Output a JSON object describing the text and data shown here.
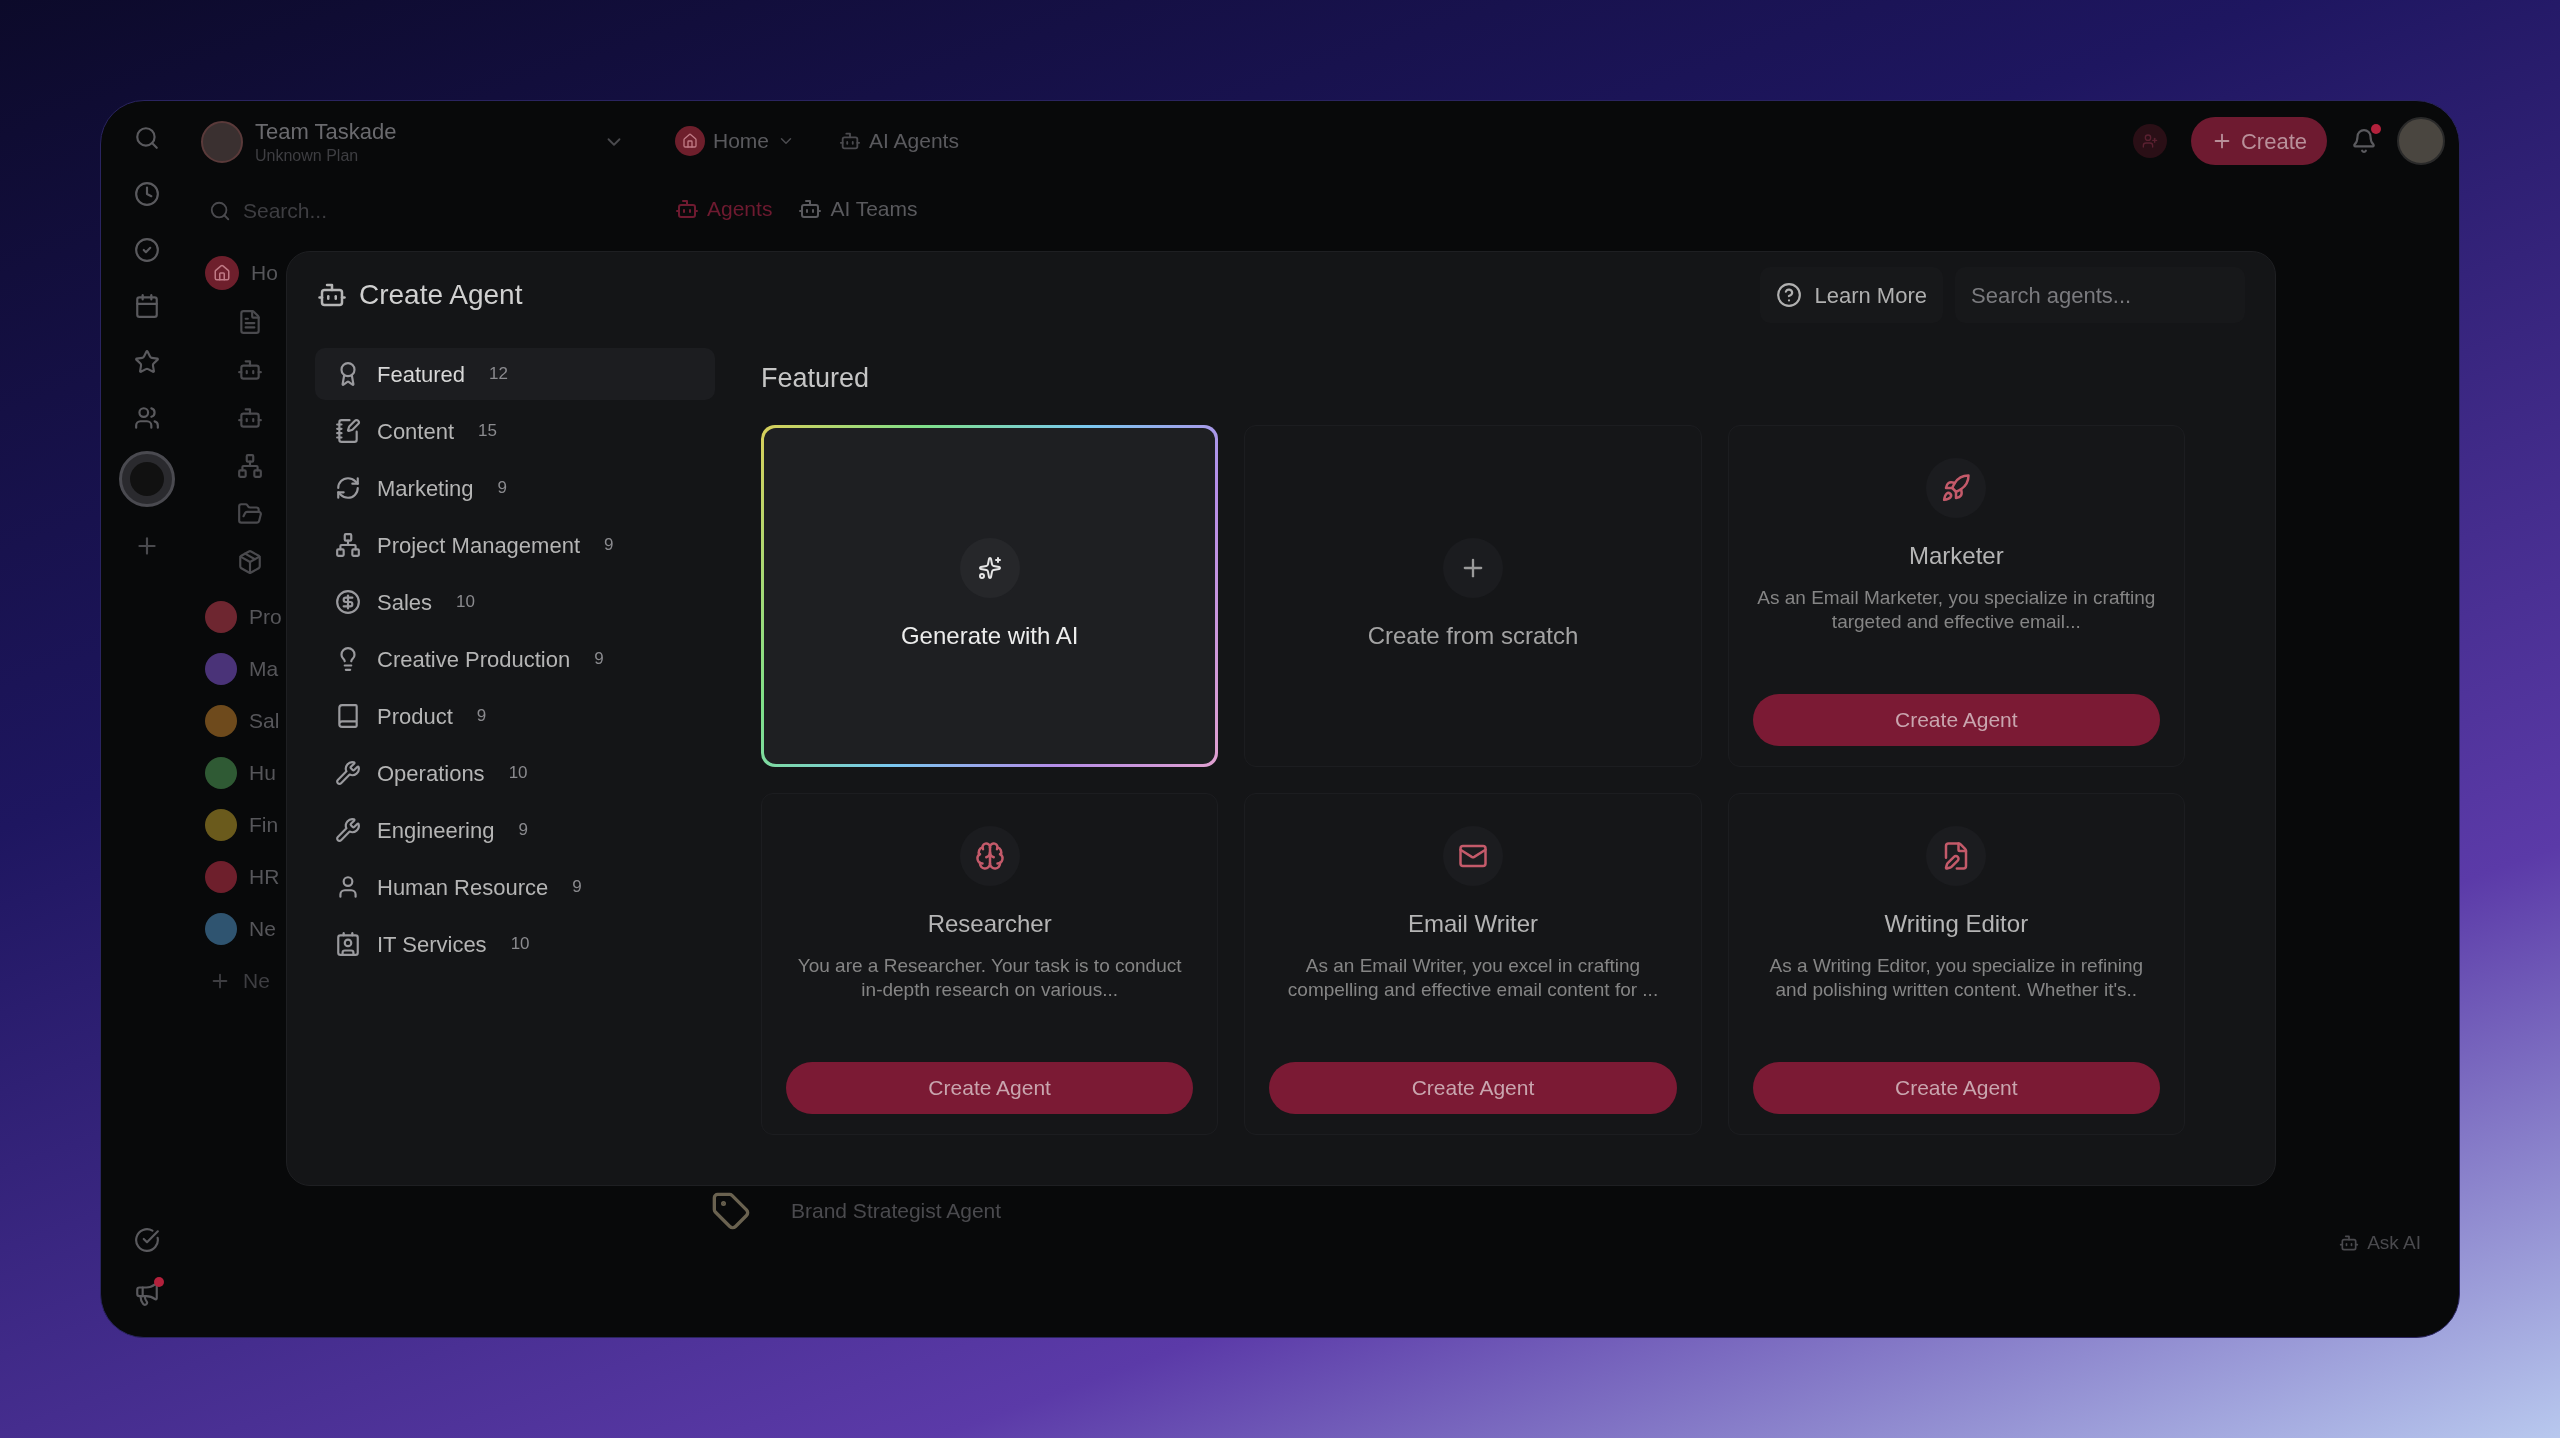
{
  "sidebar": {
    "team": {
      "name": "Team Taskade",
      "plan": "Unknown Plan"
    },
    "search": {
      "placeholder": "Search..."
    },
    "home": {
      "label": "Ho"
    },
    "spaces": [
      {
        "label": "Pro",
        "color": "#6e2630"
      },
      {
        "label": "Ma",
        "color": "#4a3378"
      },
      {
        "label": "Sal",
        "color": "#6e4a1c"
      },
      {
        "label": "Hu",
        "color": "#2f5a34"
      },
      {
        "label": "Fin",
        "color": "#6a5a1c"
      },
      {
        "label": "HR",
        "color": "#6e1f2c"
      },
      {
        "label": "Ne",
        "color": "#2f5470"
      }
    ],
    "new_item": {
      "label": "Ne"
    }
  },
  "topbar": {
    "breadcrumbs": [
      {
        "label": "Home"
      },
      {
        "label": "AI Agents"
      }
    ],
    "create_button": "Create",
    "notifications_unread": true
  },
  "tabs": [
    {
      "label": "Agents",
      "selected": true
    },
    {
      "label": "AI Teams",
      "selected": false
    }
  ],
  "modal": {
    "title": "Create Agent",
    "learn_more": "Learn More",
    "search": {
      "placeholder": "Search agents..."
    },
    "categories": [
      {
        "label": "Featured",
        "count": "12",
        "selected": true
      },
      {
        "label": "Content",
        "count": "15",
        "selected": false
      },
      {
        "label": "Marketing",
        "count": "9",
        "selected": false
      },
      {
        "label": "Project Management",
        "count": "9",
        "selected": false
      },
      {
        "label": "Sales",
        "count": "10",
        "selected": false
      },
      {
        "label": "Creative Production",
        "count": "9",
        "selected": false
      },
      {
        "label": "Product",
        "count": "9",
        "selected": false
      },
      {
        "label": "Operations",
        "count": "10",
        "selected": false
      },
      {
        "label": "Engineering",
        "count": "9",
        "selected": false
      },
      {
        "label": "Human Resource",
        "count": "9",
        "selected": false
      },
      {
        "label": "IT Services",
        "count": "10",
        "selected": false
      }
    ],
    "section_title": "Featured",
    "cards": [
      {
        "kind": "generate",
        "title": "Generate with AI"
      },
      {
        "kind": "scratch",
        "title": "Create from scratch"
      },
      {
        "kind": "agent",
        "title": "Marketer",
        "description": "As an Email Marketer, you specialize in crafting targeted and effective email...",
        "button": "Create Agent"
      },
      {
        "kind": "agent",
        "title": "Researcher",
        "description": "You are a Researcher. Your task is to conduct in-depth research on various...",
        "button": "Create Agent"
      },
      {
        "kind": "agent",
        "title": "Email Writer",
        "description": "As an Email Writer, you excel in crafting compelling and effective email content for ...",
        "button": "Create Agent"
      },
      {
        "kind": "agent",
        "title": "Writing Editor",
        "description": "As a Writing Editor, you specialize in refining and polishing written content. Whether it's..",
        "button": "Create Agent"
      }
    ]
  },
  "background_list": [
    {
      "label": "Brand Strategist Agent"
    }
  ],
  "ask_ai": "Ask AI"
}
